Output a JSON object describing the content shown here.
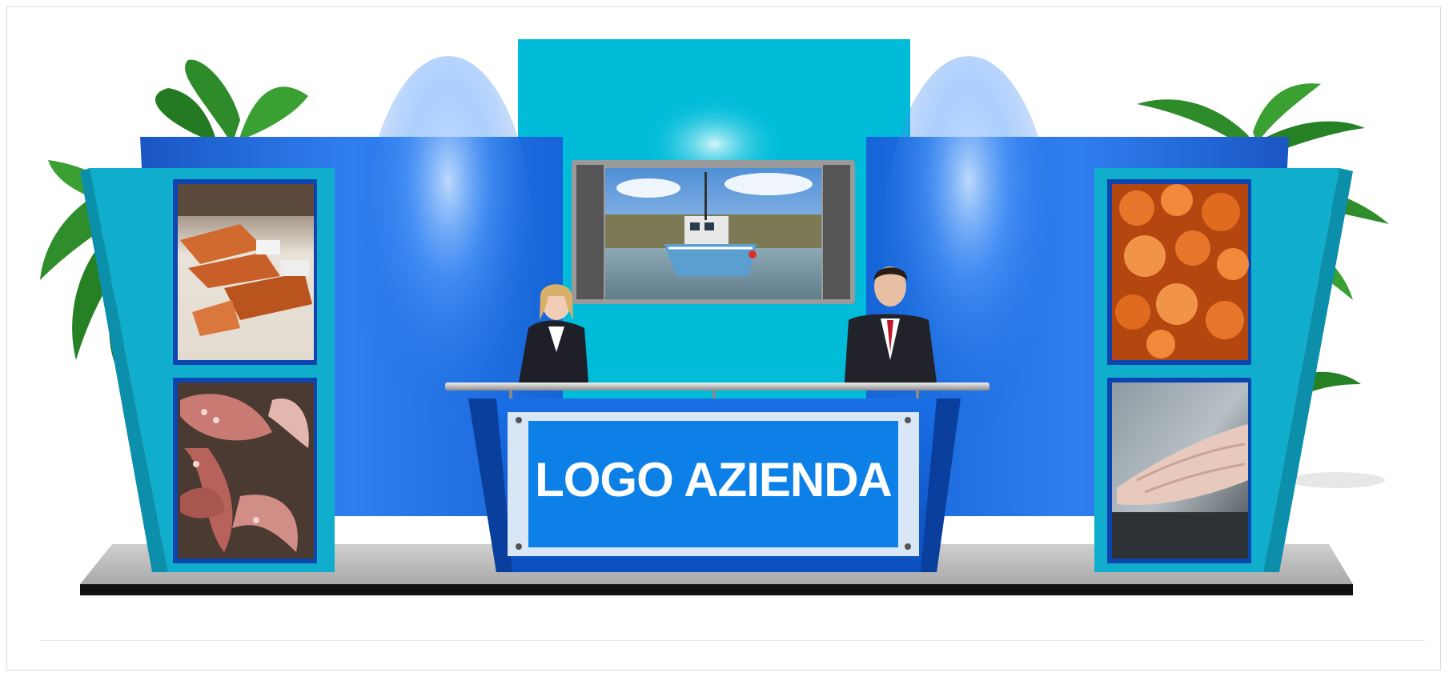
{
  "scene": {
    "logo_text": "LOGO AZIENDA",
    "colors": {
      "backdrop_center": "#00bcd9",
      "wall_blue": "#1060d8",
      "side_teal": "#10aecc",
      "desk_blue": "#0d5fd4",
      "logo_panel": "#0d80e8",
      "floor_gray": "#b9b9b9",
      "floor_edge": "#111111"
    },
    "panels": {
      "left_top": "seafood-market-photo",
      "left_bottom": "octopus-photo",
      "right_top": "shrimp-photo",
      "right_bottom": "fish-fillet-photo",
      "screen": "fishing-boat-photo"
    },
    "people": [
      "woman-in-suit",
      "man-in-suit"
    ],
    "plants": [
      "left-plant",
      "right-palm"
    ]
  }
}
